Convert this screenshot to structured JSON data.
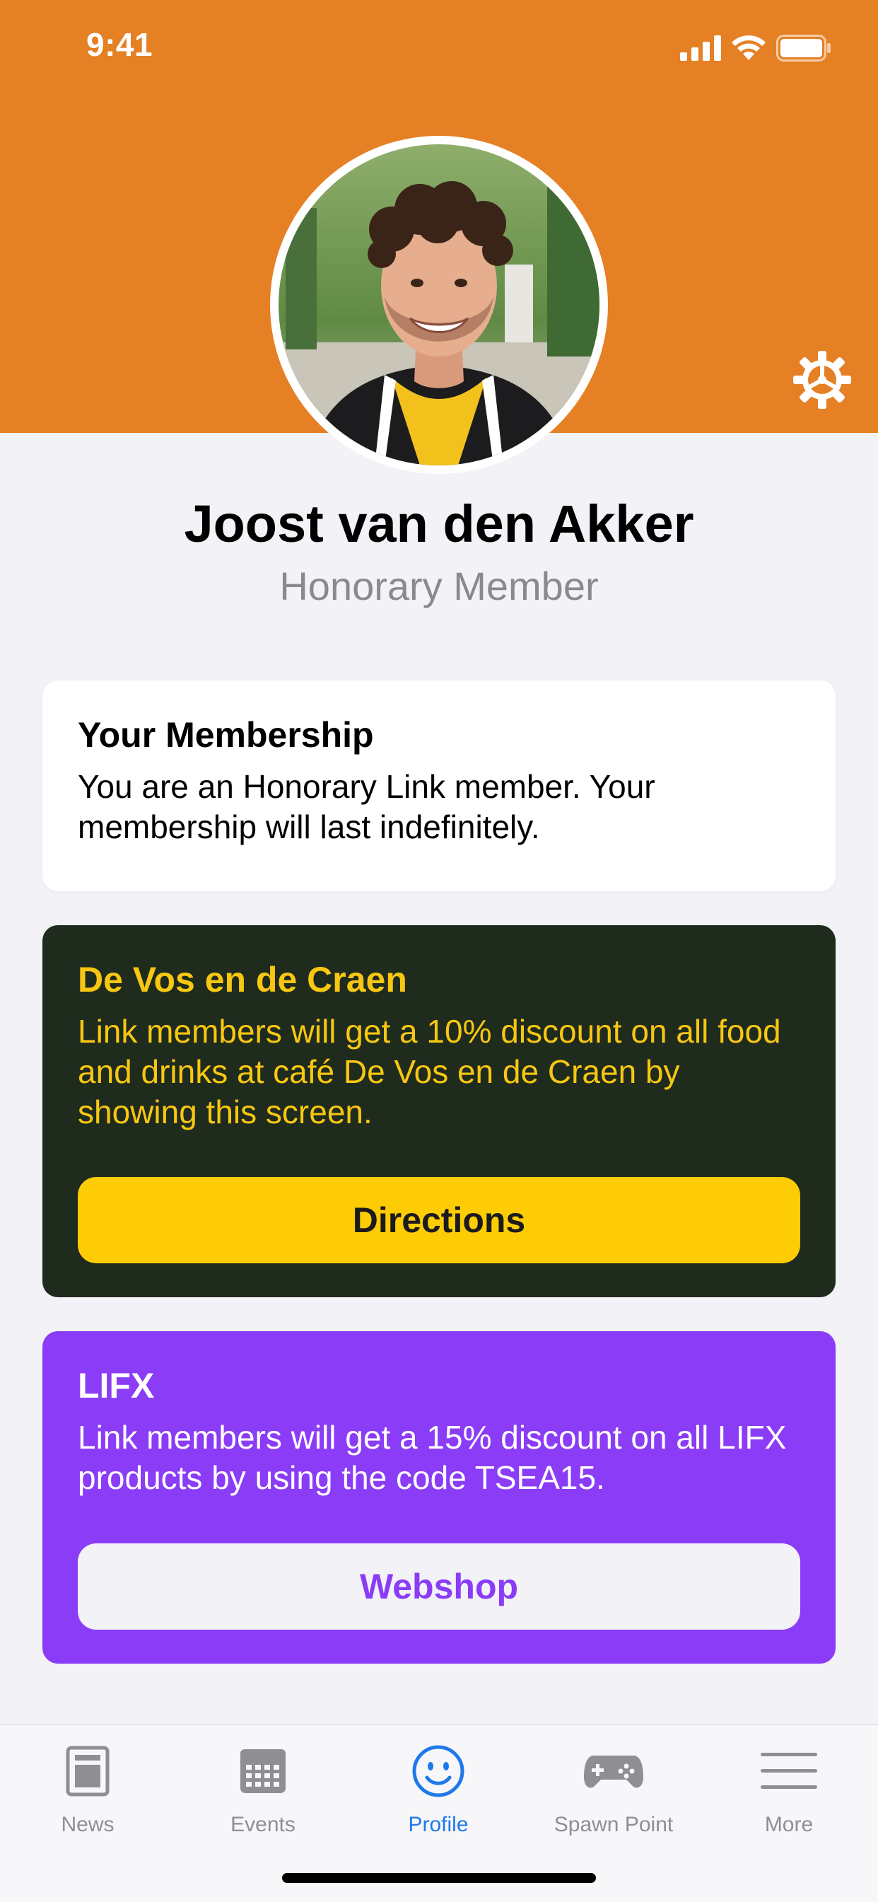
{
  "status_bar": {
    "time": "9:41",
    "icons": [
      "cellular-signal-icon",
      "wifi-icon",
      "battery-icon"
    ]
  },
  "colors": {
    "header": "#e58024",
    "vos_card_bg": "#1f2b1d",
    "vos_accent": "#fdcc05",
    "lifx_card_bg": "#8b3cf7",
    "tab_active": "#1e79ea"
  },
  "profile": {
    "name": "Joost van den Akker",
    "role": "Honorary Member",
    "settings_icon": "gear-icon"
  },
  "membership_card": {
    "title": "Your Membership",
    "text": "You are an Honorary Link member. Your membership will last indefinitely."
  },
  "vos_card": {
    "title": "De Vos en de Craen",
    "text": "Link members will get a 10% discount on all food and drinks at café De Vos en de Craen by showing this screen.",
    "button": "Directions"
  },
  "lifx_card": {
    "title": "LIFX",
    "text": "Link members will get a 15% discount on all LIFX products by using the code TSEA15.",
    "button": "Webshop"
  },
  "tab_bar": {
    "items": [
      {
        "label": "News",
        "icon": "news-icon"
      },
      {
        "label": "Events",
        "icon": "calendar-icon"
      },
      {
        "label": "Profile",
        "icon": "smiley-icon",
        "active": true
      },
      {
        "label": "Spawn Point",
        "icon": "gamepad-icon"
      },
      {
        "label": "More",
        "icon": "menu-icon"
      }
    ]
  }
}
